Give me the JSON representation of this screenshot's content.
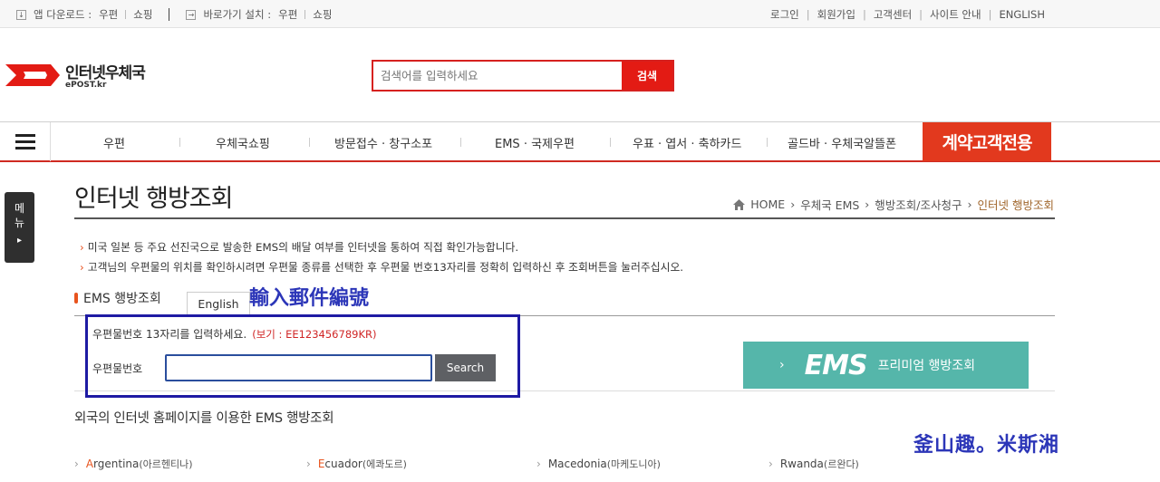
{
  "topbar": {
    "app_download_label": "앱 다운로드 :",
    "app_postal": "우편",
    "app_shopping": "쇼핑",
    "shortcut_label": "바로가기 설치 :",
    "shortcut_postal": "우편",
    "shortcut_shopping": "쇼핑",
    "links": [
      "로그인",
      "회원가입",
      "고객센터",
      "사이트 안내",
      "ENGLISH"
    ]
  },
  "logo": {
    "ko": "인터넷우체국",
    "en": "ePOST.kr"
  },
  "search": {
    "placeholder": "검색어를 입력하세요",
    "button": "검색"
  },
  "nav": {
    "items": [
      "우편",
      "우체국쇼핑",
      "방문접수 · 창구소포",
      "EMS · 국제우편",
      "우표 · 엽서 · 축하카드",
      "골드바 · 우체국알뜰폰"
    ],
    "contract": "계약고객전용"
  },
  "sidetab": {
    "label_1": "메",
    "label_2": "뉴",
    "arrow": "▸"
  },
  "page": {
    "title": "인터넷 행방조회",
    "breadcrumb": [
      "HOME",
      "우체국 EMS",
      "행방조회/조사청구",
      "인터넷 행방조회"
    ],
    "notes": [
      "미국 일본 등 주요 선진국으로 발송한 EMS의 배달 여부를 인터넷을 통하여 직접 확인가능합니다.",
      "고객님의 우편물의 위치를 확인하시려면 우편물 종류를 선택한 후 우편물 번호13자리를 정확히 입력하신 후 조회버튼을 눌러주십시오."
    ]
  },
  "ems": {
    "section_label": "EMS 행방조회",
    "english_tab": "English",
    "guide": "우편물번호 13자리를 입력하세요.",
    "example": "(보기 : EE123456789KR)",
    "field_label": "우편물번호",
    "input_value": "",
    "search_button": "Search"
  },
  "premium": {
    "arrow": "›",
    "ems": "EMS",
    "text": "프리미엄 행방조회"
  },
  "annotations": {
    "input_hint": "輸入郵件編號",
    "credit": "釜山趣。米斯湘"
  },
  "foreign": {
    "title": "외국의 인터넷 홈페이지를 이용한 EMS 행방조회",
    "countries": [
      {
        "first": "A",
        "rest": "rgentina",
        "ko": "(아르헨티나)"
      },
      {
        "first": "E",
        "rest": "cuador",
        "ko": "(에콰도르)"
      },
      {
        "first": "",
        "rest": "Macedonia",
        "ko": "(마케도니아)"
      },
      {
        "first": "",
        "rest": "Rwanda",
        "ko": "(르완다)"
      }
    ]
  },
  "colors": {
    "brand_red": "#e31b14",
    "premium_teal": "#55b6aa",
    "annotation_blue": "#2c36b8"
  }
}
